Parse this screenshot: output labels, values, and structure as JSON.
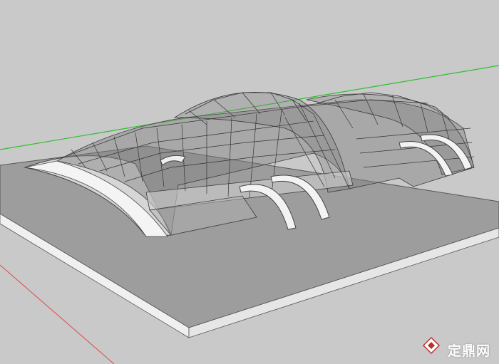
{
  "watermark": {
    "brand_text": "定鼎网",
    "logo_icon": "diamond-logo-icon"
  },
  "colors": {
    "background": "#c9c9c9",
    "ground": "#9a9a9a",
    "axis_green": "#2fbf2f",
    "axis_red": "#e04a4a",
    "glass": "#7a7a7a"
  }
}
